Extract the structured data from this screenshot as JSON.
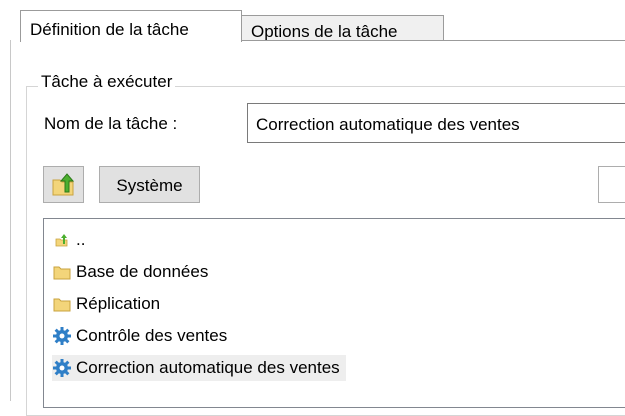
{
  "tabs": {
    "definition": "Définition de la tâche",
    "options": "Options de la tâche"
  },
  "task_group": {
    "legend": "Tâche à exécuter",
    "name_label": "Nom de la tâche :",
    "name_value": "Correction automatique des ventes"
  },
  "browser": {
    "up_icon": "folder-up-icon",
    "system_button": "Système",
    "items": [
      {
        "label": "..",
        "icon": "parent-folder-icon"
      },
      {
        "label": "Base de données",
        "icon": "folder-icon"
      },
      {
        "label": "Réplication",
        "icon": "folder-icon"
      },
      {
        "label": "Contrôle des ventes",
        "icon": "gear-icon"
      },
      {
        "label": "Correction automatique des ventes",
        "icon": "gear-icon",
        "selected": true
      }
    ]
  },
  "colors": {
    "folder": "#f3d57a",
    "gear": "#2f7fc7",
    "selection": "#eeeeee"
  }
}
